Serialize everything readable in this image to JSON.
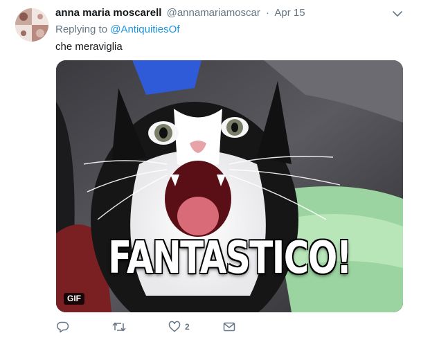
{
  "tweet": {
    "author_name": "anna maria moscarell",
    "author_handle": "@annamariamoscar",
    "separator": "·",
    "date": "Apr 15",
    "replying_prefix": "Replying to",
    "replying_to": "@AntiquitiesOf",
    "text": "che meraviglia",
    "media": {
      "caption": "FANTASTICO!",
      "badge": "GIF",
      "description_icon": "surprised-cat-gif"
    },
    "actions": {
      "reply_count": "",
      "retweet_count": "",
      "like_count": "2"
    }
  },
  "colors": {
    "link": "#1b95e0",
    "secondary_text": "#657786",
    "primary_text": "#14171a"
  }
}
